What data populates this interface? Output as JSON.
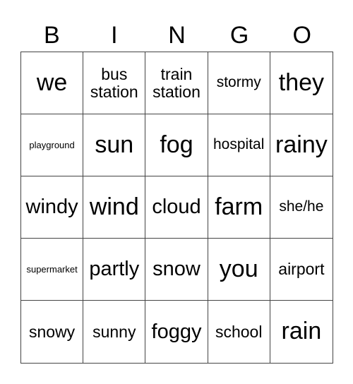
{
  "header": [
    "B",
    "I",
    "N",
    "G",
    "O"
  ],
  "cells": [
    {
      "text": "we",
      "size": "s-xl"
    },
    {
      "text": "bus station",
      "size": "s-m"
    },
    {
      "text": "train station",
      "size": "s-m"
    },
    {
      "text": "stormy",
      "size": "s-s"
    },
    {
      "text": "they",
      "size": "s-xl"
    },
    {
      "text": "playground",
      "size": "s-xs"
    },
    {
      "text": "sun",
      "size": "s-xl"
    },
    {
      "text": "fog",
      "size": "s-xl"
    },
    {
      "text": "hospital",
      "size": "s-s"
    },
    {
      "text": "rainy",
      "size": "s-xl"
    },
    {
      "text": "windy",
      "size": "s-l"
    },
    {
      "text": "wind",
      "size": "s-xl"
    },
    {
      "text": "cloud",
      "size": "s-l"
    },
    {
      "text": "farm",
      "size": "s-xl"
    },
    {
      "text": "she/he",
      "size": "s-s"
    },
    {
      "text": "supermarket",
      "size": "s-xs"
    },
    {
      "text": "partly",
      "size": "s-l"
    },
    {
      "text": "snow",
      "size": "s-l"
    },
    {
      "text": "you",
      "size": "s-xl"
    },
    {
      "text": "airport",
      "size": "s-m"
    },
    {
      "text": "snowy",
      "size": "s-m"
    },
    {
      "text": "sunny",
      "size": "s-m"
    },
    {
      "text": "foggy",
      "size": "s-l"
    },
    {
      "text": "school",
      "size": "s-m"
    },
    {
      "text": "rain",
      "size": "s-xl"
    }
  ]
}
